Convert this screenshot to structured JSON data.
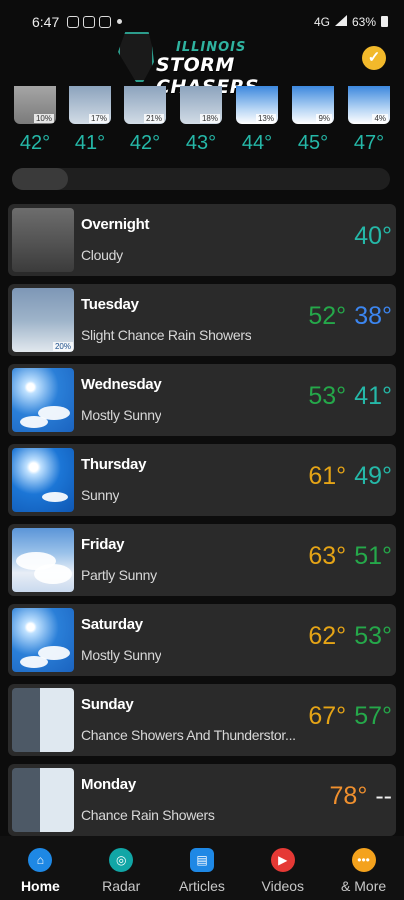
{
  "status": {
    "time": "6:47",
    "network": "4G",
    "battery": "63%"
  },
  "header": {
    "logo_line1": "ILLINOIS",
    "logo_line2": "STORM CHASERS",
    "badge_icon": "verified-check-icon"
  },
  "hourly": [
    {
      "condition": "cloudy",
      "pop": "10%",
      "temp": "42°"
    },
    {
      "condition": "rain",
      "pop": "17%",
      "temp": "41°"
    },
    {
      "condition": "rain",
      "pop": "21%",
      "temp": "42°"
    },
    {
      "condition": "rain",
      "pop": "18%",
      "temp": "43°"
    },
    {
      "condition": "showers",
      "pop": "13%",
      "temp": "44°"
    },
    {
      "condition": "showers",
      "pop": "9%",
      "temp": "45°"
    },
    {
      "condition": "showers",
      "pop": "4%",
      "temp": "47°"
    }
  ],
  "daily": [
    {
      "name": "Overnight",
      "desc": "Cloudy",
      "high": "",
      "low": "40°",
      "image": "cloudy"
    },
    {
      "name": "Tuesday",
      "desc": "Slight Chance Rain Showers",
      "high": "52°",
      "low": "38°",
      "image": "rain",
      "pop": "20%"
    },
    {
      "name": "Wednesday",
      "desc": "Mostly Sunny",
      "high": "53°",
      "low": "41°",
      "image": "sunny"
    },
    {
      "name": "Thursday",
      "desc": "Sunny",
      "high": "61°",
      "low": "49°",
      "image": "sunny"
    },
    {
      "name": "Friday",
      "desc": "Partly Sunny",
      "high": "63°",
      "low": "51°",
      "image": "partly-sunny"
    },
    {
      "name": "Saturday",
      "desc": "Mostly Sunny",
      "high": "62°",
      "low": "53°",
      "image": "sunny"
    },
    {
      "name": "Sunday",
      "desc": "Chance Showers And Thunderstor...",
      "high": "67°",
      "low": "57°",
      "image": "thunderstorm"
    },
    {
      "name": "Monday",
      "desc": "Chance Rain Showers",
      "high": "78°",
      "low": "--",
      "image": "rain-showers"
    }
  ],
  "colors": {
    "teal": "#25b8a8",
    "green": "#25a84a",
    "blue": "#3c86f0",
    "gold": "#e5a416",
    "orange": "#f0902e",
    "card": "#2a2a2a",
    "bg": "#0c0c0c"
  },
  "nav": [
    {
      "label": "Home",
      "icon": "home-icon",
      "color": "#1e88e5",
      "active": true
    },
    {
      "label": "Radar",
      "icon": "radar-icon",
      "color": "#11a6a6"
    },
    {
      "label": "Articles",
      "icon": "articles-icon",
      "color": "#1e88e5"
    },
    {
      "label": "Videos",
      "icon": "videos-icon",
      "color": "#e53935"
    },
    {
      "label": "& More",
      "icon": "more-icon",
      "color": "#f4a21d"
    }
  ]
}
